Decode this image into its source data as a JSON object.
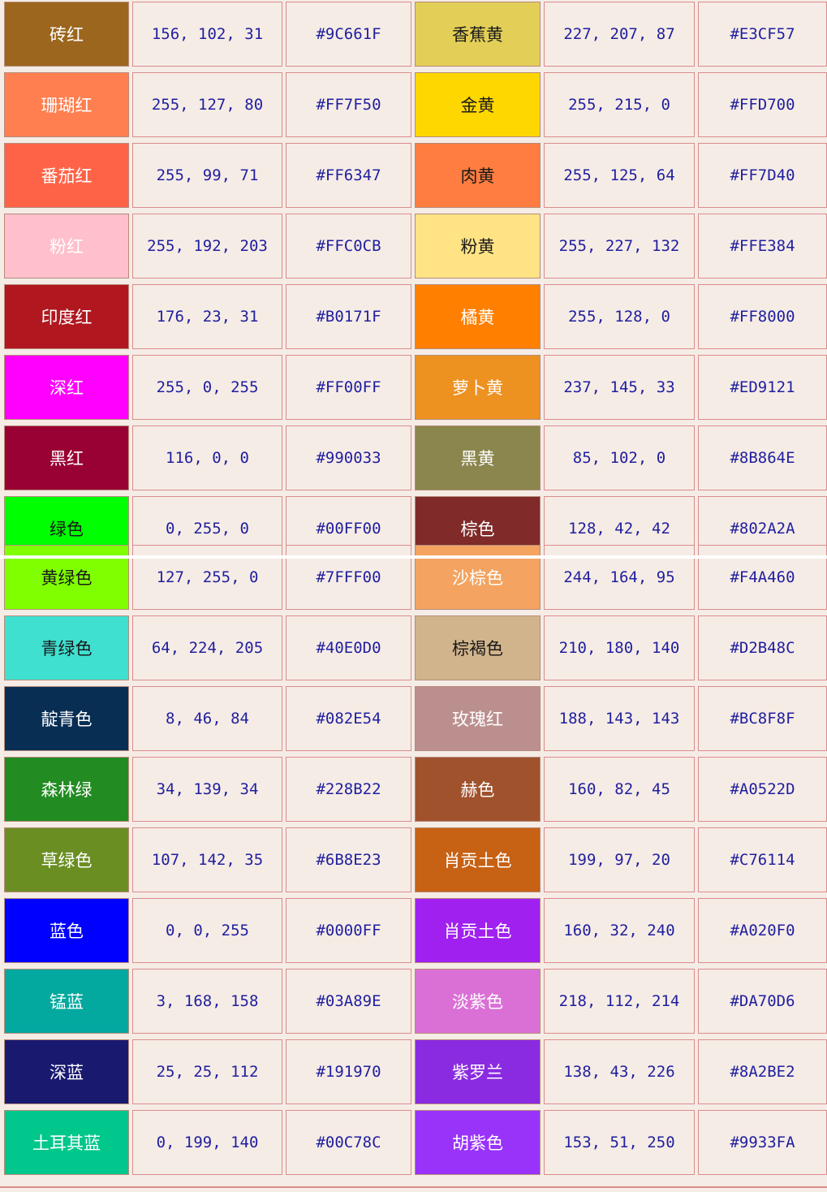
{
  "rows": [
    {
      "a": {
        "name": "砖红",
        "bg": "#9C661F",
        "fg": "#ffffff"
      },
      "a_rgb": "156,102,31",
      "a_hex": "#9C661F",
      "b": {
        "name": "香蕉黄",
        "bg": "#E3CF57",
        "fg": "#1a1a1a"
      },
      "b_rgb": "227,207,87",
      "b_hex": "#E3CF57"
    },
    {
      "a": {
        "name": "珊瑚红",
        "bg": "#FF7F50",
        "fg": "#ffffff"
      },
      "a_rgb": "255,127,80",
      "a_hex": "#FF7F50",
      "b": {
        "name": "金黄",
        "bg": "#FFD700",
        "fg": "#1a1a1a"
      },
      "b_rgb": "255,215,0",
      "b_hex": "#FFD700"
    },
    {
      "a": {
        "name": "番茄红",
        "bg": "#FF6347",
        "fg": "#ffffff"
      },
      "a_rgb": "255,99,71",
      "a_hex": "#FF6347",
      "b": {
        "name": "肉黄",
        "bg": "#FF7D40",
        "fg": "#1a1a1a"
      },
      "b_rgb": "255,125,64",
      "b_hex": "#FF7D40"
    },
    {
      "a": {
        "name": "粉红",
        "bg": "#FFC0CB",
        "fg": "#ffffff"
      },
      "a_rgb": "255,192,203",
      "a_hex": "#FFC0CB",
      "b": {
        "name": "粉黄",
        "bg": "#FFE384",
        "fg": "#1a1a1a"
      },
      "b_rgb": "255,227,132",
      "b_hex": "#FFE384"
    },
    {
      "a": {
        "name": "印度红",
        "bg": "#B0171F",
        "fg": "#ffffff"
      },
      "a_rgb": "176,23,31",
      "a_hex": "#B0171F",
      "b": {
        "name": "橘黄",
        "bg": "#FF8000",
        "fg": "#ffffff"
      },
      "b_rgb": "255,128,0",
      "b_hex": "#FF8000"
    },
    {
      "a": {
        "name": "深红",
        "bg": "#FF00FF",
        "fg": "#ffffff"
      },
      "a_rgb": "255,0,255",
      "a_hex": "#FF00FF",
      "b": {
        "name": "萝卜黄",
        "bg": "#ED9121",
        "fg": "#ffffff"
      },
      "b_rgb": "237,145,33",
      "b_hex": "#ED9121"
    },
    {
      "a": {
        "name": "黑红",
        "bg": "#990033",
        "fg": "#ffffff"
      },
      "a_rgb": "116,0,0",
      "a_hex": "#990033",
      "b": {
        "name": "黑黄",
        "bg": "#8B864E",
        "fg": "#ffffff"
      },
      "b_rgb": "85,102,0",
      "b_hex": "#8B864E"
    },
    {
      "a": {
        "name": "绿色",
        "bg": "#00FF00",
        "fg": "#1a1a1a"
      },
      "a_rgb": "0,255,0",
      "a_hex": "#00FF00",
      "b": {
        "name": "棕色",
        "bg": "#802A2A",
        "fg": "#ffffff"
      },
      "b_rgb": "128,42,42",
      "b_hex": "#802A2A"
    },
    {
      "a": {
        "name": "黄绿色",
        "bg": "#7FFF00",
        "fg": "#1a1a1a"
      },
      "a_rgb": "127,255,0",
      "a_hex": "#7FFF00",
      "b": {
        "name": "沙棕色",
        "bg": "#F4A460",
        "fg": "#ffffff"
      },
      "b_rgb": "244,164,95",
      "b_hex": "#F4A460"
    },
    {
      "a": {
        "name": "青绿色",
        "bg": "#40E0D0",
        "fg": "#1a1a1a"
      },
      "a_rgb": "64,224,205",
      "a_hex": "#40E0D0",
      "b": {
        "name": "棕褐色",
        "bg": "#D2B48C",
        "fg": "#1a1a1a"
      },
      "b_rgb": "210,180,140",
      "b_hex": "#D2B48C"
    },
    {
      "a": {
        "name": "靛青色",
        "bg": "#082E54",
        "fg": "#ffffff"
      },
      "a_rgb": "8,46,84",
      "a_hex": "#082E54",
      "b": {
        "name": "玫瑰红",
        "bg": "#BC8F8F",
        "fg": "#ffffff"
      },
      "b_rgb": "188,143,143",
      "b_hex": "#BC8F8F"
    },
    {
      "a": {
        "name": "森林绿",
        "bg": "#228B22",
        "fg": "#ffffff"
      },
      "a_rgb": "34,139,34",
      "a_hex": "#228B22",
      "b": {
        "name": "赫色",
        "bg": "#A0522D",
        "fg": "#ffffff"
      },
      "b_rgb": "160,82,45",
      "b_hex": "#A0522D"
    },
    {
      "a": {
        "name": "草绿色",
        "bg": "#6B8E23",
        "fg": "#ffffff"
      },
      "a_rgb": "107,142,35",
      "a_hex": "#6B8E23",
      "b": {
        "name": "肖贡土色",
        "bg": "#C76114",
        "fg": "#ffffff"
      },
      "b_rgb": "199,97,20",
      "b_hex": "#C76114"
    },
    {
      "a": {
        "name": "蓝色",
        "bg": "#0000FF",
        "fg": "#ffffff"
      },
      "a_rgb": "0,0,255",
      "a_hex": "#0000FF",
      "b": {
        "name": "肖贡土色",
        "bg": "#A020F0",
        "fg": "#ffffff"
      },
      "b_rgb": "160,32,240",
      "b_hex": "#A020F0"
    },
    {
      "a": {
        "name": "锰蓝",
        "bg": "#03A89E",
        "fg": "#ffffff"
      },
      "a_rgb": "3,168,158",
      "a_hex": "#03A89E",
      "b": {
        "name": "淡紫色",
        "bg": "#DA70D6",
        "fg": "#ffffff"
      },
      "b_rgb": "218,112,214",
      "b_hex": "#DA70D6"
    },
    {
      "a": {
        "name": "深蓝",
        "bg": "#191970",
        "fg": "#ffffff"
      },
      "a_rgb": "25,25,112",
      "a_hex": "#191970",
      "b": {
        "name": "紫罗兰",
        "bg": "#8A2BE2",
        "fg": "#ffffff"
      },
      "b_rgb": "138,43,226",
      "b_hex": "#8A2BE2"
    },
    {
      "a": {
        "name": "土耳其蓝",
        "bg": "#00C78C",
        "fg": "#ffffff"
      },
      "a_rgb": "0,199,140",
      "a_hex": "#00C78C",
      "b": {
        "name": "胡紫色",
        "bg": "#9933FA",
        "fg": "#ffffff"
      },
      "b_rgb": "153,51,250",
      "b_hex": "#9933FA"
    }
  ]
}
